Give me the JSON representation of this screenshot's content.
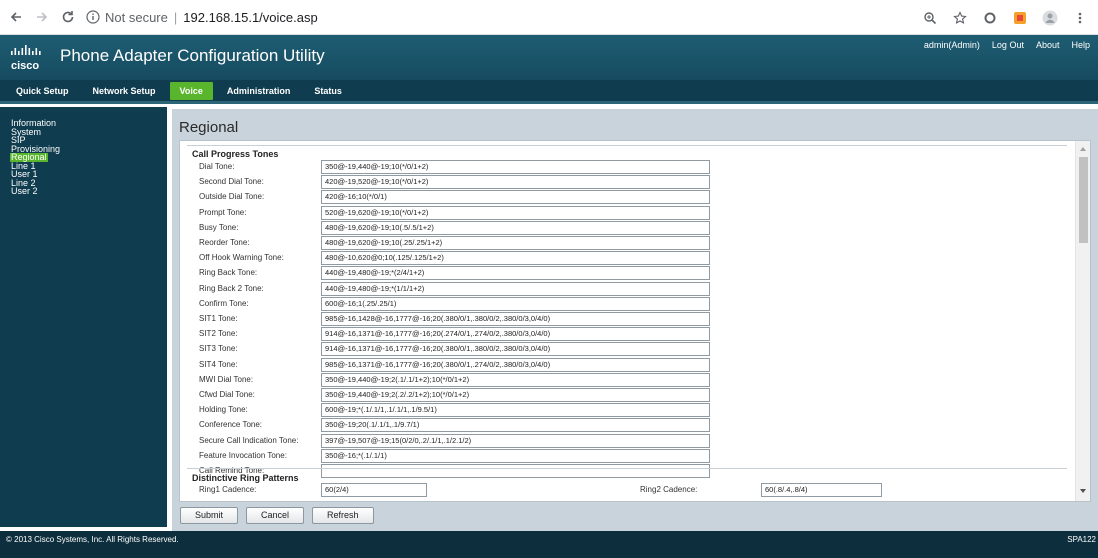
{
  "browser": {
    "security_label": "Not secure",
    "url": "192.168.15.1/voice.asp"
  },
  "header": {
    "logo_text": "cisco",
    "title": "Phone Adapter Configuration Utility",
    "user": "admin(Admin)",
    "logout": "Log Out",
    "about": "About",
    "help": "Help"
  },
  "tabs": [
    {
      "label": "Quick Setup",
      "active": false
    },
    {
      "label": "Network Setup",
      "active": false
    },
    {
      "label": "Voice",
      "active": true
    },
    {
      "label": "Administration",
      "active": false
    },
    {
      "label": "Status",
      "active": false
    }
  ],
  "sidebar": {
    "items": [
      {
        "label": "Information",
        "active": false
      },
      {
        "label": "System",
        "active": false
      },
      {
        "label": "SIP",
        "active": false
      },
      {
        "label": "Provisioning",
        "active": false
      },
      {
        "label": "Regional",
        "active": true
      },
      {
        "label": "Line 1",
        "active": false
      },
      {
        "label": "User 1",
        "active": false
      },
      {
        "label": "Line 2",
        "active": false
      },
      {
        "label": "User 2",
        "active": false
      }
    ]
  },
  "page": {
    "title": "Regional",
    "section_tones": "Call Progress Tones",
    "section_ring": "Distinctive Ring Patterns"
  },
  "tones": [
    {
      "label": "Dial Tone:",
      "value": "350@-19,440@-19;10(*/0/1+2)"
    },
    {
      "label": "Second Dial Tone:",
      "value": "420@-19,520@-19;10(*/0/1+2)"
    },
    {
      "label": "Outside Dial Tone:",
      "value": "420@-16;10(*/0/1)"
    },
    {
      "label": "Prompt Tone:",
      "value": "520@-19,620@-19;10(*/0/1+2)"
    },
    {
      "label": "Busy Tone:",
      "value": "480@-19,620@-19;10(.5/.5/1+2)"
    },
    {
      "label": "Reorder Tone:",
      "value": "480@-19,620@-19;10(.25/.25/1+2)"
    },
    {
      "label": "Off Hook Warning Tone:",
      "value": "480@-10,620@0;10(.125/.125/1+2)"
    },
    {
      "label": "Ring Back Tone:",
      "value": "440@-19,480@-19;*(2/4/1+2)"
    },
    {
      "label": "Ring Back 2 Tone:",
      "value": "440@-19,480@-19;*(1/1/1+2)"
    },
    {
      "label": "Confirm Tone:",
      "value": "600@-16;1(.25/.25/1)"
    },
    {
      "label": "SIT1 Tone:",
      "value": "985@-16,1428@-16,1777@-16;20(.380/0/1,.380/0/2,.380/0/3,0/4/0)"
    },
    {
      "label": "SIT2 Tone:",
      "value": "914@-16,1371@-16,1777@-16;20(.274/0/1,.274/0/2,.380/0/3,0/4/0)"
    },
    {
      "label": "SIT3 Tone:",
      "value": "914@-16,1371@-16,1777@-16;20(.380/0/1,.380/0/2,.380/0/3,0/4/0)"
    },
    {
      "label": "SIT4 Tone:",
      "value": "985@-16,1371@-16,1777@-16;20(.380/0/1,.274/0/2,.380/0/3,0/4/0)"
    },
    {
      "label": "MWI Dial Tone:",
      "value": "350@-19,440@-19;2(.1/.1/1+2);10(*/0/1+2)"
    },
    {
      "label": "Cfwd Dial Tone:",
      "value": "350@-19,440@-19;2(.2/.2/1+2);10(*/0/1+2)"
    },
    {
      "label": "Holding Tone:",
      "value": "600@-19;*(.1/.1/1,.1/.1/1,.1/9.5/1)"
    },
    {
      "label": "Conference Tone:",
      "value": "350@-19;20(.1/.1/1,.1/9.7/1)"
    },
    {
      "label": "Secure Call Indication Tone:",
      "value": "397@-19,507@-19;15(0/2/0,.2/.1/1,.1/2.1/2)"
    },
    {
      "label": "Feature Invocation Tone:",
      "value": "350@-16;*(.1/.1/1)"
    },
    {
      "label": "Call Remind Tone:",
      "value": ""
    }
  ],
  "ring": {
    "ring1_label": "Ring1 Cadence:",
    "ring1_value": "60(2/4)",
    "ring2_label": "Ring2 Cadence:",
    "ring2_value": "60(.8/.4,.8/4)"
  },
  "buttons": {
    "submit": "Submit",
    "cancel": "Cancel",
    "refresh": "Refresh"
  },
  "footer": {
    "copyright": "© 2013 Cisco Systems, Inc. All Rights Reserved.",
    "model": "SPA122"
  }
}
